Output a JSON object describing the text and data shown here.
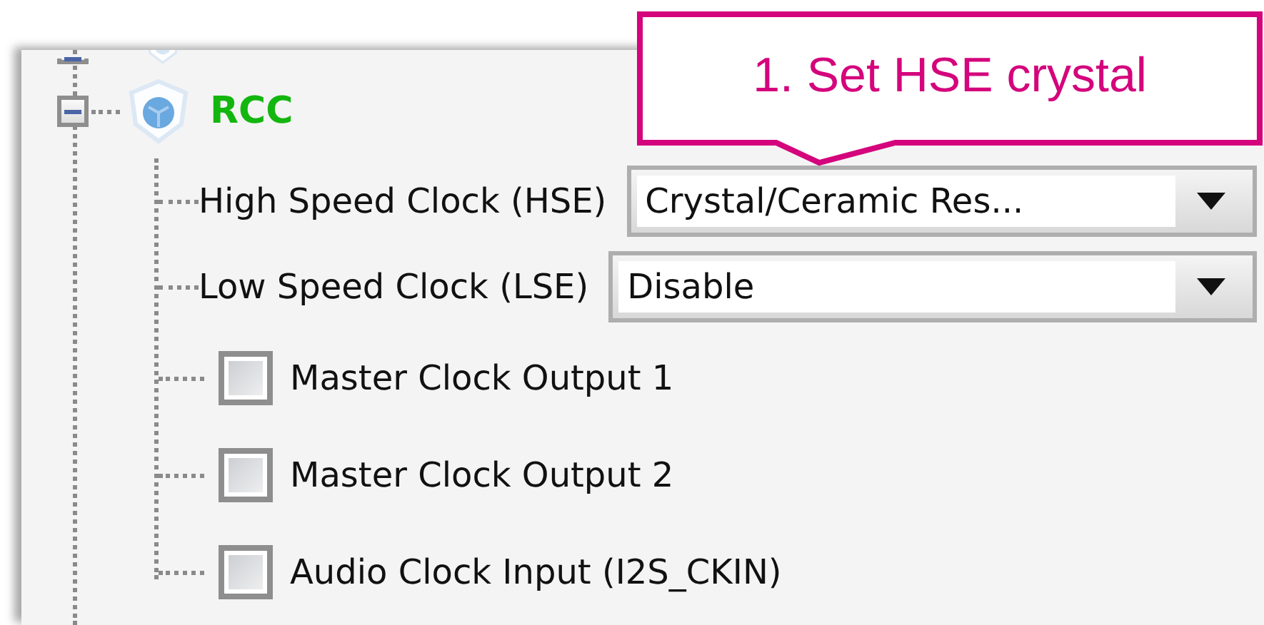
{
  "node": {
    "label": "RCC",
    "expanded": true
  },
  "callout": {
    "text": "1. Set HSE crystal"
  },
  "settings": [
    {
      "kind": "combo",
      "label": "High Speed Clock (HSE)",
      "value": "Crystal/Ceramic Res..."
    },
    {
      "kind": "combo",
      "label": "Low Speed Clock (LSE)",
      "value": "Disable"
    },
    {
      "kind": "checkbox",
      "label": "Master Clock Output 1",
      "checked": false
    },
    {
      "kind": "checkbox",
      "label": "Master Clock Output 2",
      "checked": false
    },
    {
      "kind": "checkbox",
      "label": "Audio Clock Input (I2S_CKIN)",
      "checked": false
    }
  ]
}
